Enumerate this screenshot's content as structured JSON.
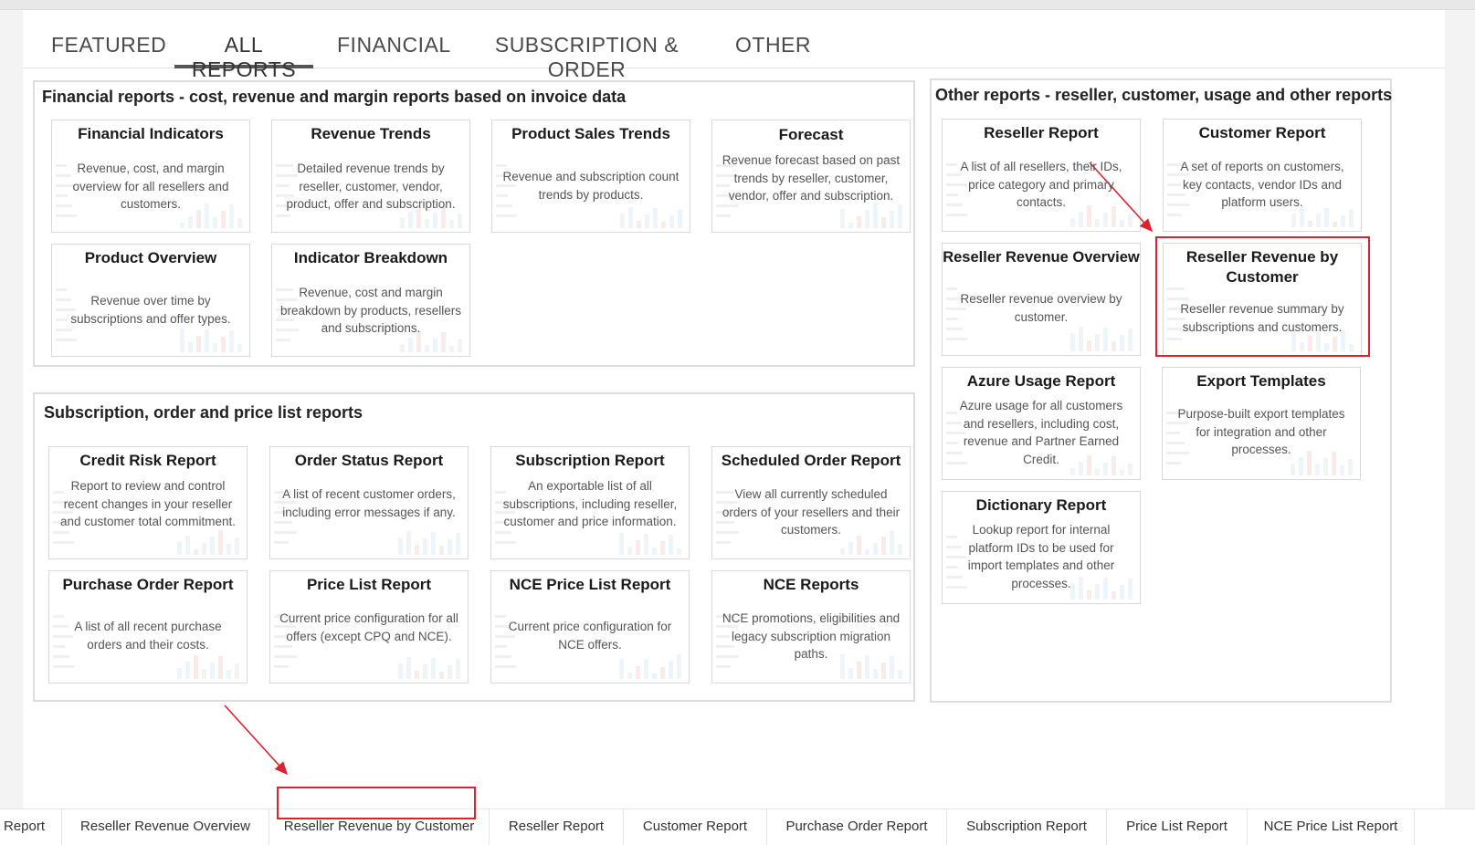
{
  "tabs": [
    {
      "label": "FEATURED",
      "active": false
    },
    {
      "label": "ALL REPORTS",
      "active": true
    },
    {
      "label": "FINANCIAL",
      "active": false
    },
    {
      "label": "SUBSCRIPTION & ORDER",
      "active": false
    },
    {
      "label": "OTHER",
      "active": false
    }
  ],
  "financial_panel": {
    "title": "Financial reports - cost, revenue and margin reports based on invoice data",
    "cards": [
      {
        "title": "Financial Indicators",
        "desc": "Revenue, cost, and margin overview for all resellers and customers."
      },
      {
        "title": "Revenue Trends",
        "desc": "Detailed revenue trends by reseller, customer, vendor, product, offer and subscription."
      },
      {
        "title": "Product Sales Trends",
        "desc": "Revenue and subscription count trends by products."
      },
      {
        "title": "Forecast",
        "desc": "Revenue forecast based on past trends by reseller, customer, vendor, offer and subscription."
      },
      {
        "title": "Product Overview",
        "desc": "Revenue over time by subscriptions and offer types."
      },
      {
        "title": "Indicator Breakdown",
        "desc": "Revenue, cost and margin breakdown by products, resellers and subscriptions."
      }
    ]
  },
  "subscription_panel": {
    "title": "Subscription, order and price list reports",
    "cards": [
      {
        "title": "Credit Risk Report",
        "desc": "Report to review and control recent changes in your reseller and customer total commitment."
      },
      {
        "title": "Order Status Report",
        "desc": "A list of recent customer orders, including error messages if any."
      },
      {
        "title": "Subscription Report",
        "desc": "An exportable list of all subscriptions, including reseller, customer and price information."
      },
      {
        "title": "Scheduled Order Report",
        "desc": "View all currently scheduled orders of your resellers and their customers."
      },
      {
        "title": "Purchase Order Report",
        "desc": "A list of all recent purchase orders and their costs."
      },
      {
        "title": "Price List Report",
        "desc": "Current price configuration for all offers (except CPQ and NCE)."
      },
      {
        "title": "NCE Price List Report",
        "desc": "Current price configuration for NCE offers."
      },
      {
        "title": "NCE Reports",
        "desc": "NCE promotions, eligibilities and legacy subscription migration paths."
      }
    ]
  },
  "other_panel": {
    "title": "Other reports - reseller, customer, usage and other reports",
    "cards": [
      {
        "title": "Reseller Report",
        "desc": "A list of all resellers, their IDs, price category and primary contacts."
      },
      {
        "title": "Customer Report",
        "desc": "A set of reports on customers, key contacts, vendor IDs and platform users."
      },
      {
        "title": "Reseller Revenue Overview",
        "desc": "Reseller revenue overview by customer."
      },
      {
        "title": "Reseller Revenue by Customer",
        "desc": "Reseller revenue summary by subscriptions and customers."
      },
      {
        "title": "Azure Usage Report",
        "desc": "Azure usage for all customers and resellers, including cost, revenue and Partner Earned Credit."
      },
      {
        "title": "Export Templates",
        "desc": "Purpose-built export templates for integration and other processes."
      },
      {
        "title": "Dictionary Report",
        "desc": "Lookup report for internal platform IDs to be used for import templates and other processes."
      }
    ]
  },
  "bottom_tabs": [
    {
      "label": "Report"
    },
    {
      "label": "Reseller Revenue Overview"
    },
    {
      "label": "Reseller Revenue by Customer",
      "highlighted": true
    },
    {
      "label": "Reseller Report"
    },
    {
      "label": "Customer Report"
    },
    {
      "label": "Purchase Order Report"
    },
    {
      "label": "Subscription Report"
    },
    {
      "label": "Price List Report"
    },
    {
      "label": "NCE Price List Report"
    }
  ],
  "colors": {
    "highlight": "#d9232e",
    "tab_underline": "#555555"
  }
}
